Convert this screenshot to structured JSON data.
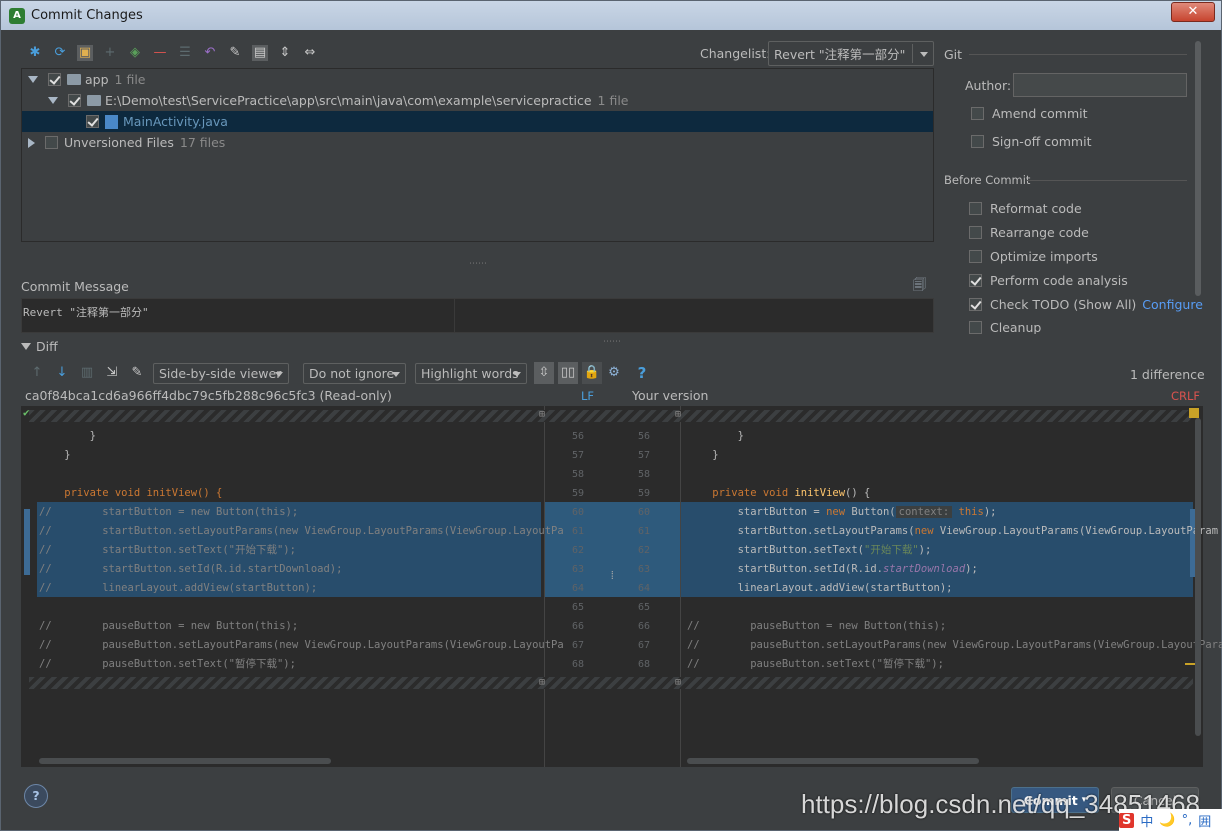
{
  "window": {
    "title": "Commit Changes",
    "close_label": "✕"
  },
  "toolbar": {
    "icons": [
      "refresh-pin-icon",
      "refresh-icon",
      "group-by-directory-icon",
      "add-icon",
      "shelve-icon",
      "remove-icon",
      "diff-icon",
      "revert-icon",
      "edit-source-icon",
      "show-diff-icon",
      "expand-all-icon",
      "collapse-all-icon"
    ]
  },
  "changelist": {
    "label": "Changelist:",
    "value": "Revert \"注释第一部分\""
  },
  "tree": {
    "rows": [
      {
        "name": "app",
        "count": "1 file"
      },
      {
        "name": "E:\\Demo\\test\\ServicePractice\\app\\src\\main\\java\\com\\example\\servicepractice",
        "count": "1 file"
      },
      {
        "name": "MainActivity.java",
        "count": ""
      },
      {
        "name": "Unversioned Files",
        "count": "17 files"
      }
    ]
  },
  "commit_message": {
    "label": "Commit Message",
    "text": "Revert \"注释第一部分\""
  },
  "git": {
    "section": "Git",
    "author_label": "Author:",
    "author_value": "",
    "amend": "Amend commit",
    "signoff": "Sign-off commit"
  },
  "before_commit": {
    "section": "Before Commit",
    "options": [
      {
        "label": "Reformat code",
        "checked": false
      },
      {
        "label": "Rearrange code",
        "checked": false
      },
      {
        "label": "Optimize imports",
        "checked": false
      },
      {
        "label": "Perform code analysis",
        "checked": true
      },
      {
        "label": "Check TODO (Show All)",
        "checked": true
      },
      {
        "label": "Cleanup",
        "checked": false
      }
    ],
    "configure": "Configure"
  },
  "diff": {
    "section": "Diff",
    "viewer": "Side-by-side viewer",
    "ignore": "Do not ignore",
    "highlight": "Highlight words",
    "help": "?",
    "count": "1 difference",
    "left_title": "ca0f84bca1cd6a966ff4dbc79c5fb288c96c5fc3 (Read-only)",
    "left_sep": "LF",
    "right_title": "Your version",
    "right_sep": "CRLF",
    "line_numbers": [
      "56",
      "57",
      "58",
      "59",
      "60",
      "61",
      "62",
      "63",
      "64",
      "65",
      "66",
      "67",
      "68"
    ],
    "left_lines": [
      "        }",
      "    }",
      "",
      "    private void initView() {",
      "//        startButton = new Button(this);",
      "//        startButton.setLayoutParams(new ViewGroup.LayoutParams(ViewGroup.LayoutPa",
      "//        startButton.setText(\"开始下载\");",
      "//        startButton.setId(R.id.startDownload);",
      "//        linearLayout.addView(startButton);",
      "",
      "//        pauseButton = new Button(this);",
      "//        pauseButton.setLayoutParams(new ViewGroup.LayoutParams(ViewGroup.LayoutPa",
      "//        pauseButton.setText(\"暂停下载\");"
    ],
    "right_plain": {
      "l56": "        }",
      "l57": "    }",
      "l59a": "    private void ",
      "l59b": "initView",
      "l59c": "() {",
      "r60a": "        startButton = ",
      "r60b": "new",
      "r60c": " Button(",
      "r60hint": "context:",
      "r60d": "this",
      "r60e": ");",
      "r61a": "        startButton.setLayoutParams(",
      "r61b": "new",
      "r61c": " ViewGroup.LayoutParams(ViewGroup.LayoutParam",
      "r62a": "        startButton.setText(",
      "r62b": "\"开始下载\"",
      "r62c": ");",
      "r63a": "        startButton.setId(R.id.",
      "r63b": "startDownload",
      "r63c": ");",
      "r64": "        linearLayout.addView(startButton);",
      "r66": "//        pauseButton = new Button(this);",
      "r67": "//        pauseButton.setLayoutParams(new ViewGroup.LayoutParams(ViewGroup.LayoutParam",
      "r68": "//        pauseButton.setText(\"暂停下载\");"
    }
  },
  "footer": {
    "help": "?",
    "commit": "Commit",
    "cancel": "Cancel"
  },
  "watermark": "https://blog.csdn.net/qq_34851468",
  "ime": {
    "a": "S",
    "b": "中",
    "c": "🌙",
    "d": "°,",
    "e": "囲"
  }
}
